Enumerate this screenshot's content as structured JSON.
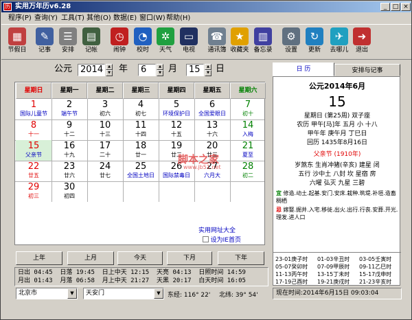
{
  "window": {
    "title": "实用万年历v6.28",
    "icon": "calendar-app-icon"
  },
  "menu": [
    "程序(P)",
    "查询(Y)",
    "工具(T)",
    "其他(O)",
    "数据(E)",
    "窗口(W)",
    "帮助(H)"
  ],
  "toolbar": [
    {
      "label": "节假日",
      "icon": "holiday-icon",
      "color": "#c04040"
    },
    {
      "label": "记事",
      "icon": "notebook-icon",
      "color": "#4060a0"
    },
    {
      "label": "安排",
      "icon": "schedule-icon",
      "color": "#808080"
    },
    {
      "label": "记帐",
      "icon": "ledger-icon",
      "color": "#406040"
    },
    {
      "label": "闹钟",
      "icon": "alarm-clock-icon",
      "color": "#c02020"
    },
    {
      "label": "校时",
      "icon": "clock-sync-icon",
      "color": "#2060c0"
    },
    {
      "label": "天气",
      "icon": "weather-icon",
      "color": "#20a040"
    },
    {
      "label": "电视",
      "icon": "tv-icon",
      "color": "#203060"
    },
    {
      "label": "通讯簿",
      "icon": "address-book-icon",
      "color": "#708090"
    },
    {
      "label": "收藏夹",
      "icon": "favorites-star-icon",
      "color": "#e0a000"
    },
    {
      "label": "备忘录",
      "icon": "memo-icon",
      "color": "#4040a0"
    },
    {
      "label": "设置",
      "icon": "settings-icon",
      "color": "#607080"
    },
    {
      "label": "更新",
      "icon": "update-icon",
      "color": "#2080c0"
    },
    {
      "label": "去哪儿",
      "icon": "travel-camel-icon",
      "color": "#20a0c0"
    },
    {
      "label": "退出",
      "icon": "exit-door-icon",
      "color": "#c03030"
    }
  ],
  "datebar": {
    "era": "公元",
    "year": "2014",
    "year_unit": "年",
    "month": "6",
    "month_unit": "月",
    "day": "15",
    "day_unit": "日"
  },
  "weekdays": [
    "星期日",
    "星期一",
    "星期二",
    "星期三",
    "星期四",
    "星期五",
    "星期六"
  ],
  "calendar": [
    [
      {
        "d": "1",
        "s": "国际儿童节",
        "c": "blue"
      },
      {
        "d": "2",
        "s": "端午节",
        "c": "blue"
      },
      {
        "d": "3",
        "s": "初六"
      },
      {
        "d": "4",
        "s": "初七"
      },
      {
        "d": "5",
        "s": "环境保护日",
        "c": "blue"
      },
      {
        "d": "6",
        "s": "全国爱眼日",
        "c": "blue"
      },
      {
        "d": "7",
        "s": "初十"
      }
    ],
    [
      {
        "d": "8",
        "s": "十一"
      },
      {
        "d": "9",
        "s": "十二"
      },
      {
        "d": "10",
        "s": "十三"
      },
      {
        "d": "11",
        "s": "十四"
      },
      {
        "d": "12",
        "s": "十五"
      },
      {
        "d": "13",
        "s": "十六"
      },
      {
        "d": "14",
        "s": "入梅",
        "c": "blue"
      }
    ],
    [
      {
        "d": "15",
        "s": "父亲节",
        "c": "blue",
        "sel": true
      },
      {
        "d": "16",
        "s": "十九"
      },
      {
        "d": "17",
        "s": "二十"
      },
      {
        "d": "18",
        "s": "廿一"
      },
      {
        "d": "19",
        "s": "廿二"
      },
      {
        "d": "20",
        "s": "廿三"
      },
      {
        "d": "21",
        "s": "夏至",
        "c": "blue"
      }
    ],
    [
      {
        "d": "22",
        "s": "廿五"
      },
      {
        "d": "23",
        "s": "廿六"
      },
      {
        "d": "24",
        "s": "廿七"
      },
      {
        "d": "25",
        "s": "全国土地日",
        "c": "blue"
      },
      {
        "d": "26",
        "s": "国际禁毒日",
        "c": "blue"
      },
      {
        "d": "27",
        "s": "六月大",
        "c": "blue"
      },
      {
        "d": "28",
        "s": "初二"
      }
    ],
    [
      {
        "d": "29",
        "s": "初三"
      },
      {
        "d": "30",
        "s": "初四"
      },
      {
        "d": "",
        "s": ""
      },
      {
        "d": "",
        "s": ""
      },
      {
        "d": "",
        "s": ""
      },
      {
        "d": "",
        "s": ""
      },
      {
        "d": "",
        "s": ""
      }
    ]
  ],
  "links": {
    "site": "实用网址大全",
    "homepage": "设为IE首页"
  },
  "nav": [
    "上年",
    "上月",
    "今天",
    "下月",
    "下年"
  ],
  "sun": {
    "l1": "日出 04:45  日落 19:45  日上中天 12:15  天亮 04:13  日照时间 14:59",
    "l2": "月出 01:43  月落 06:58  月上中天 21:27  天黑 20:17  白天时间 16:05"
  },
  "location": {
    "city": "北京市",
    "district": "天安门",
    "lon": "东经:  116° 22'",
    "lat": "北纬:  39° 54'"
  },
  "tabs": {
    "calendar": "日  历",
    "notes": "安排与记事"
  },
  "detail": {
    "title": "公元2014年6月",
    "day": "15",
    "l1": "星期日 (第25周) 双子座",
    "l2": "农历 甲午[马]年 五月 小 十八",
    "l3": "甲午年 庚午月 丁巳日",
    "l4": "回历 1435年8月16日",
    "festival": "父亲节 (1910年)",
    "l5": "岁煞东 生肖冲猪(辛亥) 建星 闭",
    "l6": "五行 沙中土 八封 坎 星宿 房",
    "l7": "六曜 弘灭 九星 三碧",
    "yi_label": "宜",
    "yi": "修造.动土.起基.安门.安床.栽种.筑堤.补垣.造畜稠栖",
    "ji_label": "忌",
    "ji": "嫁娶.掘井.入宅.移徙.出火.出行.行丧.安葬.开光.理发.进人口",
    "hours": [
      [
        "23-01庚子时",
        "01-03辛丑时",
        "03-05壬寅时"
      ],
      [
        "05-07癸卯时",
        "07-09甲辰时",
        "09-11乙巳时"
      ],
      [
        "11-13丙午时",
        "13-15丁未时",
        "15-17戊申时"
      ],
      [
        "17-19己酉时",
        "19-21庚戌时",
        "21-23辛亥时"
      ]
    ]
  },
  "status": "现在时间:2014年6月15日  09:03:04",
  "watermark": {
    "main": "脚本之家",
    "sub": "www.jb51.net"
  }
}
